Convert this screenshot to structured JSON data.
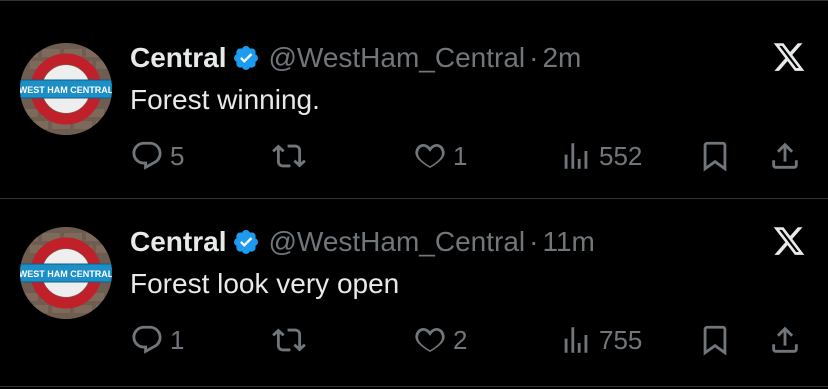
{
  "colors": {
    "background": "#000000",
    "text": "#e7e9ea",
    "muted": "#71767b",
    "verified": "#1d9bf0",
    "divider": "#2f3336"
  },
  "icons": [
    "reply-icon",
    "retweet-icon",
    "like-icon",
    "views-icon",
    "bookmark-icon",
    "share-icon",
    "x-logo-icon",
    "verified-badge-icon"
  ],
  "tweets": [
    {
      "display_name": "Central",
      "handle": "@WestHam_Central",
      "separator": "·",
      "time": "2m",
      "avatar_sign_text": "WEST HAM CENTRAL",
      "text": "Forest winning.",
      "replies": "5",
      "retweets": "",
      "likes": "1",
      "views": "552"
    },
    {
      "display_name": "Central",
      "handle": "@WestHam_Central",
      "separator": "·",
      "time": "11m",
      "avatar_sign_text": "WEST HAM CENTRAL",
      "text": "Forest look very open",
      "replies": "1",
      "retweets": "",
      "likes": "2",
      "views": "755"
    }
  ]
}
